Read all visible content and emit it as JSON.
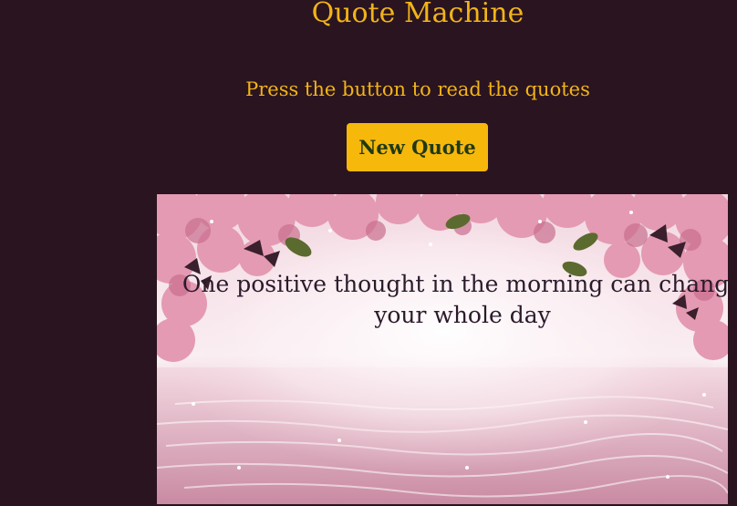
{
  "app": {
    "title": "Quote Machine",
    "instructions": "Press the button to read the quotes"
  },
  "controls": {
    "new_quote_label": "New Quote"
  },
  "quote": {
    "text": "One positive thought in the morning can change your whole day"
  },
  "colors": {
    "background": "#2a1420",
    "accent": "#f2b418",
    "button_bg": "#f7b80c",
    "button_text": "#1f3a14",
    "quote_text": "#2b1a2a"
  },
  "icons": {
    "background_picture": "pink-flowers-butterflies-water-image"
  }
}
